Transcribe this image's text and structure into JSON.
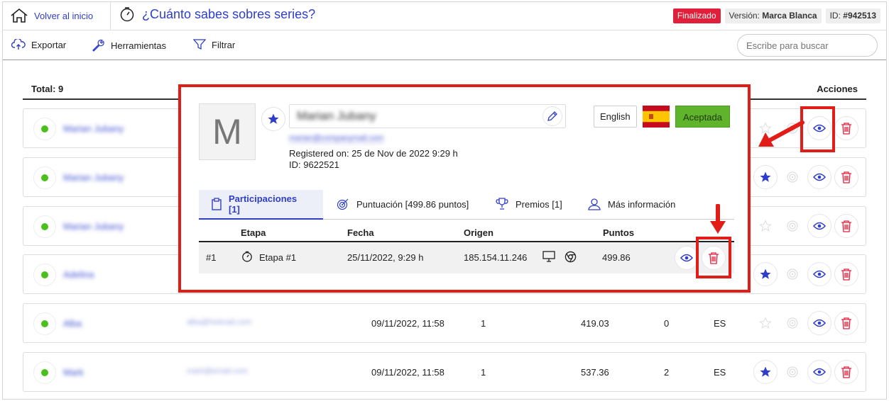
{
  "header": {
    "home_label": "Volver al inicio",
    "title": "¿Cuánto sabes sobres series?",
    "status_badge": "Finalizado",
    "version_label": "Versión:",
    "version_value": "Marca Blanca",
    "id_label": "ID:",
    "id_value": "#942513"
  },
  "toolbar": {
    "export_label": "Exportar",
    "tools_label": "Herramientas",
    "filter_label": "Filtrar",
    "search_placeholder": "Escribe para buscar"
  },
  "list": {
    "total_label": "Total: 9",
    "actions_header": "Acciones",
    "rows": [
      {
        "name": "Marian Jubany",
        "email": "",
        "date": "",
        "participations": "",
        "points": "",
        "prizes": "",
        "lang": "",
        "favorite": false
      },
      {
        "name": "Marian Jubany",
        "email": "",
        "date": "",
        "participations": "",
        "points": "",
        "prizes": "",
        "lang": "",
        "favorite": true
      },
      {
        "name": "Marian Jubany",
        "email": "",
        "date": "",
        "participations": "",
        "points": "",
        "prizes": "",
        "lang": "",
        "favorite": false
      },
      {
        "name": "Adelina",
        "email": "",
        "date": "",
        "participations": "",
        "points": "",
        "prizes": "",
        "lang": "",
        "favorite": true
      },
      {
        "name": "Alba",
        "email": "alba@hotmail.com",
        "date": "09/11/2022, 11:58",
        "participations": "1",
        "points": "419.03",
        "prizes": "0",
        "lang": "ES",
        "favorite": false
      },
      {
        "name": "Mark",
        "email": "mark@email.com",
        "date": "09/11/2022, 11:58",
        "participations": "1",
        "points": "537.36",
        "prizes": "2",
        "lang": "ES",
        "favorite": true
      }
    ]
  },
  "modal": {
    "avatar_letter": "M",
    "name": "Marian Jubany",
    "email": "marian@companymail.com",
    "registered": "Registered on: 25 de Nov de 2022 9:29 h",
    "id_line": "ID: 9622521",
    "language": "English",
    "status": "Aceptada",
    "tabs": [
      {
        "label": "Participaciones [1]",
        "active": true
      },
      {
        "label": "Puntuación [499.86 puntos]",
        "active": false
      },
      {
        "label": "Premios [1]",
        "active": false
      },
      {
        "label": "Más información",
        "active": false
      }
    ],
    "table": {
      "headers": [
        "Etapa",
        "Fecha",
        "Origen",
        "Puntos"
      ],
      "rows": [
        {
          "index": "#1",
          "stage": "Etapa #1",
          "date": "25/11/2022, 9:29 h",
          "origin": "185.154.11.246",
          "points": "499.86"
        }
      ]
    }
  },
  "colors": {
    "accent": "#2f3ec9",
    "danger": "#e0203a",
    "annotation": "#e21c16",
    "success": "#5fb42b"
  }
}
